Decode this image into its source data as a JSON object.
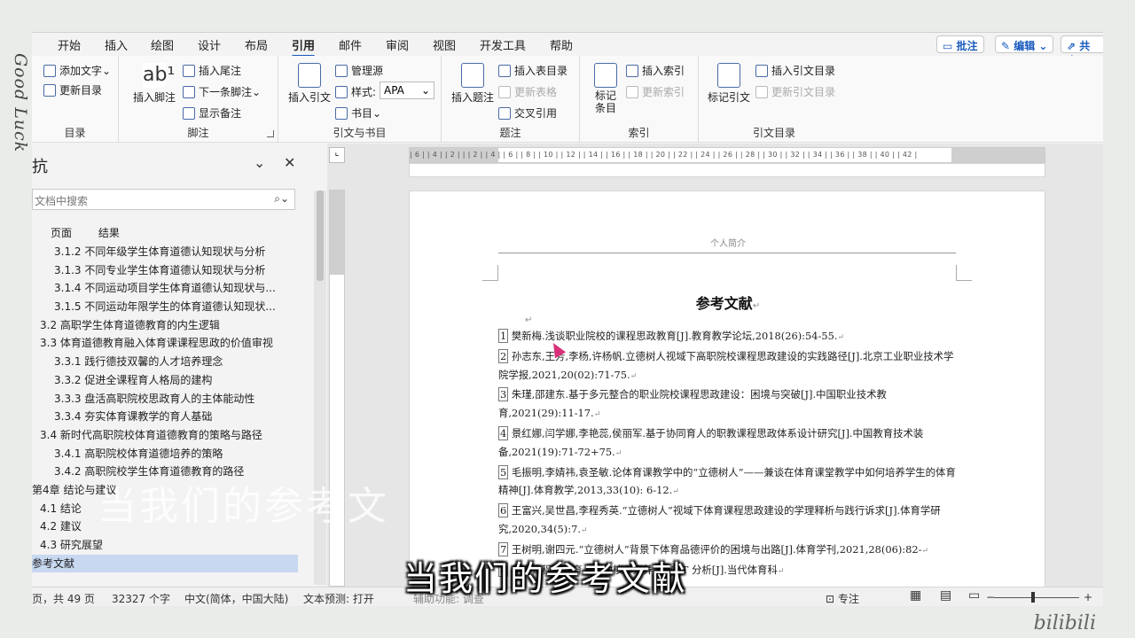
{
  "frame": {
    "left_text": "Good Luck",
    "watermark": "bilibili"
  },
  "tabs": [
    "开始",
    "插入",
    "绘图",
    "设计",
    "布局",
    "引用",
    "邮件",
    "审阅",
    "视图",
    "开发工具",
    "帮助"
  ],
  "active_tab": "引用",
  "top_right": {
    "comments": "批注",
    "editing": "编辑",
    "share": "共享"
  },
  "ribbon": {
    "toc": {
      "add_text": "添加文字",
      "update_toc": "更新目录",
      "label": "目录"
    },
    "footnotes": {
      "insert_footnote": "插入脚注",
      "insert_endnote": "插入尾注",
      "next_footnote": "下一条脚注",
      "show_notes": "显示备注",
      "label": "脚注"
    },
    "citations": {
      "insert_citation": "插入引文",
      "manage_sources": "管理源",
      "style_label": "样式:",
      "style_value": "APA",
      "bibliography": "书目",
      "label": "引文与书目"
    },
    "captions": {
      "insert_caption": "插入题注",
      "insert_table_of_figures": "插入表目录",
      "update_table": "更新表格",
      "cross_reference": "交叉引用",
      "label": "题注"
    },
    "index": {
      "mark_entry": "标记条目",
      "insert_index": "插入索引",
      "update_index": "更新索引",
      "label": "索引"
    },
    "authorities": {
      "mark_citation": "标记引文",
      "insert_toa": "插入引文目录",
      "update_toa": "更新引文目录",
      "label": "引文目录"
    }
  },
  "nav": {
    "title": "抗",
    "search_placeholder": "文档中搜索",
    "tabs": [
      "页面",
      "结果"
    ],
    "items": [
      {
        "text": "3.1.2 不同年级学生体育道德认知现状与分析",
        "level": 3
      },
      {
        "text": "3.1.3 不同专业学生体育道德认知现状与分析",
        "level": 3
      },
      {
        "text": "3.1.4 不同运动项目学生体育道德认知现状与...",
        "level": 3
      },
      {
        "text": "3.1.5 不同运动年限学生的体育道德认知现状...",
        "level": 3
      },
      {
        "text": "3.2 高职学生体育道德教育的内生逻辑",
        "level": 2
      },
      {
        "text": "3.3 体育道德教育融入体育课课程思政的价值审视",
        "level": 2
      },
      {
        "text": "3.3.1 践行德技双馨的人才培养理念",
        "level": 3
      },
      {
        "text": "3.3.2 促进全课程育人格局的建构",
        "level": 3
      },
      {
        "text": "3.3.3 盘活高职院校思政育人的主体能动性",
        "level": 3
      },
      {
        "text": "3.3.4 夯实体育课教学的育人基础",
        "level": 3
      },
      {
        "text": "3.4 新时代高职院校体育道德教育的策略与路径",
        "level": 2
      },
      {
        "text": "3.4.1 高职院校体育道德培养的策略",
        "level": 3
      },
      {
        "text": "3.4.2 高职院校学生体育道德教育的路径",
        "level": 3
      },
      {
        "text": "第4章 结论与建议",
        "level": 1
      },
      {
        "text": "4.1 结论",
        "level": 2
      },
      {
        "text": "4.2 建议",
        "level": 2
      },
      {
        "text": "4.3 研究展望",
        "level": 2
      },
      {
        "text": "参考文献",
        "level": 1,
        "selected": true
      }
    ]
  },
  "ruler_text": "| 6 |  | 4 |  | 2 |  |  | 2 |  | 4 |  | 6 |  | 8 |  | 10 |  | 12 |  | 14 |  | 16 |  | 18 |  | 20 |  | 22 |  | 24 |  | 26 |  | 28 |  | 30 |  | 32 |  | 34 |  | 36 |  | 38 |  | 40 |  | 42 |",
  "document": {
    "header": "个人简介",
    "heading": "参考文献",
    "references": [
      {
        "num": "1",
        "text": " 樊新梅.浅谈职业院校的课程思政教育[J].教育教学论坛,2018(26):54-55."
      },
      {
        "num": "2",
        "text": " 孙志东,王芳,李杨,许杨帆.立德树人视域下高职院校课程思政建设的实践路径[J].北京工业职业技术学院学报,2021,20(02):71-75."
      },
      {
        "num": "3",
        "text": " 朱瑾,邵建东.基于多元整合的职业院校课程思政建设：困境与突破[J].中国职业技术教育,2021(29):11-17."
      },
      {
        "num": "4",
        "text": " 景红娜,闫学娜,李艳蕊,侯丽军.基于协同育人的职教课程思政体系设计研究[J].中国教育技术装备,2021(19):71-72+75."
      },
      {
        "num": "5",
        "text": " 毛振明,李婧祎,袁圣敏.论体育课教学中的“立德树人”——兼谈在体育课堂教学中如何培养学生的体育精神[J].体育教学,2013,33(10): 6-12."
      },
      {
        "num": "6",
        "text": " 王富兴,吴世昌,李程秀英.“立德树人”视域下体育课程思政建设的学理释析与践行诉求[J].体育学研究,2020,34(5):7."
      },
      {
        "num": "7",
        "text": " 王树明,谢四元.“立德树人”背景下体育品德评价的困境与出路[J].体育学刊,2021,28(06):82-"
      },
      {
        "num": "8",
        "text": " 体育课程思政育人互动核心素养 SWOT 分析[J].当代体育科"
      }
    ]
  },
  "status": {
    "page": "页，共 49 页",
    "words": "32327 个字",
    "language": "中文(简体，中国大陆)",
    "text_prediction": "文本预测: 打开",
    "focus": "专注",
    "accessibility": "辅助功能: 调查"
  },
  "captions": {
    "shadow": "当我们的参考文",
    "main": "当我们的参考文献"
  },
  "colors": {
    "accent": "#185abd",
    "selected_nav": "#c7d8f0",
    "cursor": "#d8317a"
  }
}
